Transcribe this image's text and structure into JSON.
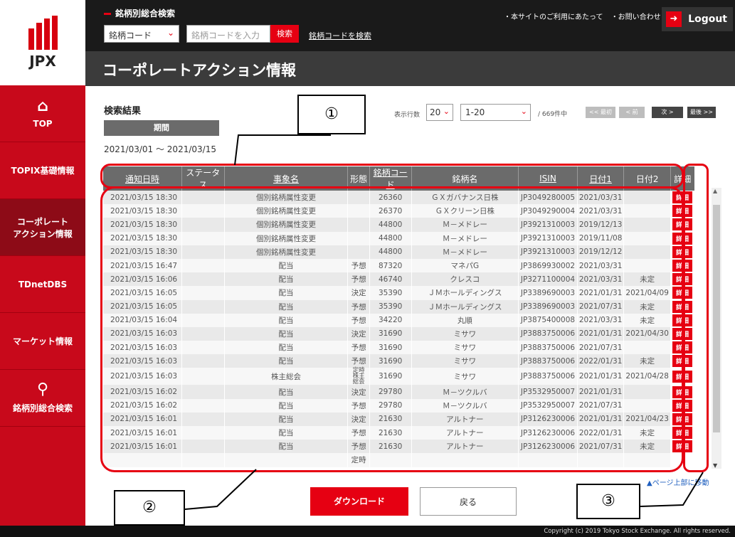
{
  "brand": {
    "logo_text": "JPX"
  },
  "sidebar": {
    "items": [
      {
        "label": "TOP",
        "icon": "home-icon"
      },
      {
        "label": "TOPIX基礎情報"
      },
      {
        "label": "コーポレート\nアクション情報"
      },
      {
        "label": "TDnetDBS"
      },
      {
        "label": "マーケット情報"
      },
      {
        "label": "銘柄別総合検索",
        "icon": "search-icon"
      }
    ]
  },
  "header": {
    "search_title": "銘柄別総合検索",
    "code_select": "銘柄コード",
    "code_placeholder": "銘柄コードを入力",
    "search_button": "検索",
    "code_search_link": "銘柄コードを検索",
    "links": [
      "・本サイトのご利用にあたって",
      "・お問い合わせ"
    ],
    "logout": "Logout"
  },
  "page_title": "コーポレートアクション情報",
  "results": {
    "label": "検索結果",
    "period_label": "期間",
    "period_value": "2021/03/01 ～ 2021/03/15"
  },
  "pagination": {
    "rows_label": "表示行数",
    "rows_value": "20",
    "range_value": "1-20",
    "total": "/ 669件中",
    "first": "<< 最初",
    "prev": "< 前",
    "next": "次 >",
    "last": "最後 >>"
  },
  "table": {
    "headers": [
      "通知日時",
      "ステータス",
      "事象名",
      "形態",
      "銘柄コード",
      "銘柄名",
      "ISIN",
      "日付1",
      "日付2",
      "詳細"
    ],
    "detail_label": "詳細",
    "rows": [
      [
        "2021/03/15 18:30",
        "",
        "個別銘柄属性変更",
        "",
        "26360",
        "ＧＸガバナンス日株",
        "JP3049280005",
        "2021/03/31",
        ""
      ],
      [
        "2021/03/15 18:30",
        "",
        "個別銘柄属性変更",
        "",
        "26370",
        "ＧＸクリーン日株",
        "JP3049290004",
        "2021/03/31",
        ""
      ],
      [
        "2021/03/15 18:30",
        "",
        "個別銘柄属性変更",
        "",
        "44800",
        "Ｍ－メドレー",
        "JP3921310003",
        "2019/12/13",
        ""
      ],
      [
        "2021/03/15 18:30",
        "",
        "個別銘柄属性変更",
        "",
        "44800",
        "Ｍ－メドレー",
        "JP3921310003",
        "2019/11/08",
        ""
      ],
      [
        "2021/03/15 18:30",
        "",
        "個別銘柄属性変更",
        "",
        "44800",
        "Ｍ－メドレー",
        "JP3921310003",
        "2019/12/12",
        ""
      ],
      [
        "2021/03/15 16:47",
        "",
        "配当",
        "予想",
        "87320",
        "マネパG",
        "JP3869930002",
        "2021/03/31",
        ""
      ],
      [
        "2021/03/15 16:06",
        "",
        "配当",
        "予想",
        "46740",
        "クレスコ",
        "JP3271100004",
        "2021/03/31",
        "未定"
      ],
      [
        "2021/03/15 16:05",
        "",
        "配当",
        "決定",
        "35390",
        "ＪＭホールディングス",
        "JP3389690003",
        "2021/01/31",
        "2021/04/09"
      ],
      [
        "2021/03/15 16:05",
        "",
        "配当",
        "予想",
        "35390",
        "ＪＭホールディングス",
        "JP3389690003",
        "2021/07/31",
        "未定"
      ],
      [
        "2021/03/15 16:04",
        "",
        "配当",
        "予想",
        "34220",
        "丸順",
        "JP3875400008",
        "2021/03/31",
        "未定"
      ],
      [
        "2021/03/15 16:03",
        "",
        "配当",
        "決定",
        "31690",
        "ミサワ",
        "JP3883750006",
        "2021/01/31",
        "2021/04/30"
      ],
      [
        "2021/03/15 16:03",
        "",
        "配当",
        "予想",
        "31690",
        "ミサワ",
        "JP3883750006",
        "2021/07/31",
        ""
      ],
      [
        "2021/03/15 16:03",
        "",
        "配当",
        "予想",
        "31690",
        "ミサワ",
        "JP3883750006",
        "2022/01/31",
        "未定"
      ],
      [
        "2021/03/15 16:03",
        "",
        "株主総会",
        "定時株主総会",
        "31690",
        "ミサワ",
        "JP3883750006",
        "2021/01/31",
        "2021/04/28"
      ],
      [
        "2021/03/15 16:02",
        "",
        "配当",
        "決定",
        "29780",
        "Ｍ－ツクルバ",
        "JP3532950007",
        "2021/01/31",
        ""
      ],
      [
        "2021/03/15 16:02",
        "",
        "配当",
        "予想",
        "29780",
        "Ｍ－ツクルバ",
        "JP3532950007",
        "2021/07/31",
        ""
      ],
      [
        "2021/03/15 16:01",
        "",
        "配当",
        "決定",
        "21630",
        "アルトナー",
        "JP3126230006",
        "2021/01/31",
        "2021/04/23"
      ],
      [
        "2021/03/15 16:01",
        "",
        "配当",
        "予想",
        "21630",
        "アルトナー",
        "JP3126230006",
        "2022/01/31",
        "未定"
      ],
      [
        "2021/03/15 16:01",
        "",
        "配当",
        "予想",
        "21630",
        "アルトナー",
        "JP3126230006",
        "2021/07/31",
        "未定"
      ],
      [
        "",
        "",
        "",
        "定時",
        "",
        "",
        "",
        "",
        ""
      ]
    ]
  },
  "page_top_link": "▲ページ上部に移動",
  "buttons": {
    "download": "ダウンロード",
    "back": "戻る"
  },
  "footer": "Copyright (c) 2019 Tokyo Stock Exchange. All rights reserved.",
  "annotations": [
    "①",
    "②",
    "③"
  ],
  "colors": {
    "brand_red": "#e60012",
    "sidebar_red": "#c8091b",
    "sidebar_active": "#8d0b17",
    "header_dark": "#1a1a1a"
  }
}
